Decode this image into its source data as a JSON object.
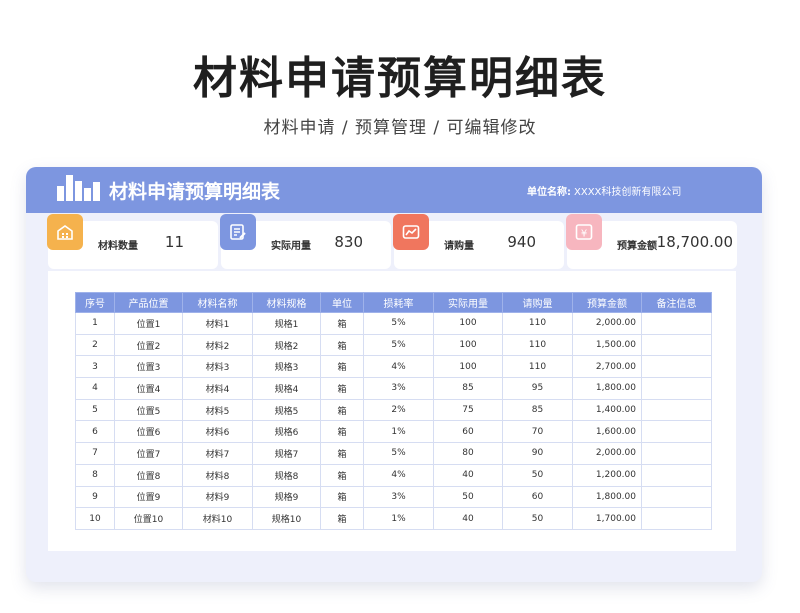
{
  "title": "材料申请预算明细表",
  "subtitle": "材料申请 /  预算管理 /  可编辑修改",
  "card": {
    "title": "材料申请预算明细表",
    "unit_label": "单位名称:",
    "unit_value": "XXXX科技创新有限公司",
    "header_color": "#7d96e0"
  },
  "stats": [
    {
      "label": "材料数量",
      "value": "11",
      "icon": "building-icon",
      "color": "#f5b24d"
    },
    {
      "label": "实际用量",
      "value": "830",
      "icon": "edit-note-icon",
      "color": "#7d96e0"
    },
    {
      "label": "请购量",
      "value": "940",
      "icon": "trend-chart-icon",
      "color": "#f0765e"
    },
    {
      "label": "预算金额",
      "value": "18,700.00",
      "icon": "yen-icon",
      "color": "#f7b6bf"
    }
  ],
  "table": {
    "headers": [
      "序号",
      "产品位置",
      "材料名称",
      "材料规格",
      "单位",
      "损耗率",
      "实际用量",
      "请购量",
      "预算金额",
      "备注信息"
    ],
    "rows": [
      [
        "1",
        "位置1",
        "材料1",
        "规格1",
        "箱",
        "5%",
        "100",
        "110",
        "2,000.00",
        ""
      ],
      [
        "2",
        "位置2",
        "材料2",
        "规格2",
        "箱",
        "5%",
        "100",
        "110",
        "1,500.00",
        ""
      ],
      [
        "3",
        "位置3",
        "材料3",
        "规格3",
        "箱",
        "4%",
        "100",
        "110",
        "2,700.00",
        ""
      ],
      [
        "4",
        "位置4",
        "材料4",
        "规格4",
        "箱",
        "3%",
        "85",
        "95",
        "1,800.00",
        ""
      ],
      [
        "5",
        "位置5",
        "材料5",
        "规格5",
        "箱",
        "2%",
        "75",
        "85",
        "1,400.00",
        ""
      ],
      [
        "6",
        "位置6",
        "材料6",
        "规格6",
        "箱",
        "1%",
        "60",
        "70",
        "1,600.00",
        ""
      ],
      [
        "7",
        "位置7",
        "材料7",
        "规格7",
        "箱",
        "5%",
        "80",
        "90",
        "2,000.00",
        ""
      ],
      [
        "8",
        "位置8",
        "材料8",
        "规格8",
        "箱",
        "4%",
        "40",
        "50",
        "1,200.00",
        ""
      ],
      [
        "9",
        "位置9",
        "材料9",
        "规格9",
        "箱",
        "3%",
        "50",
        "60",
        "1,800.00",
        ""
      ],
      [
        "10",
        "位置10",
        "材料10",
        "规格10",
        "箱",
        "1%",
        "40",
        "50",
        "1,700.00",
        ""
      ]
    ]
  }
}
